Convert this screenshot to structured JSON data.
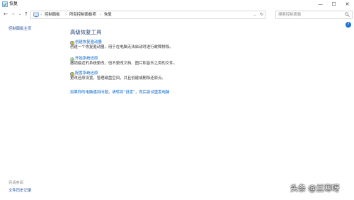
{
  "window": {
    "title": "恢复",
    "minimize_glyph": "—",
    "maximize_glyph": "☐",
    "close_glyph": "✕"
  },
  "address": {
    "crumbs": [
      "控制面板",
      "所有控制面板项",
      "恢复"
    ],
    "search_placeholder": "搜索控制面板"
  },
  "sidebar": {
    "home_link": "控制面板主页",
    "see_also_header": "另请参阅",
    "file_history_link": "文件历史记录"
  },
  "main": {
    "heading": "高级恢复工具",
    "tasks": [
      {
        "link": "创建恢复驱动器",
        "description": "创建一个恢复驱动器，用于在电脑无法启动时进行故障排除。",
        "icon": "shield-icon"
      },
      {
        "link": "开始系统还原",
        "description": "撤销最近的系统更改，但不更改文档、图片和音乐之类的文件。",
        "icon": "restore-icon"
      },
      {
        "link": "配置系统还原",
        "description": "更改还原设置，管理磁盘空间，并且创建或删除还原点。",
        "icon": "shield-icon"
      }
    ],
    "problem_link": "如果你的电脑遇到问题，请转到“设置”，然后尝试重置电脑"
  },
  "watermark": "头条 @兰寒呀",
  "colors": {
    "link": "#0066cc",
    "heading": "#1e3f7a",
    "help": "#1e6fd9"
  }
}
